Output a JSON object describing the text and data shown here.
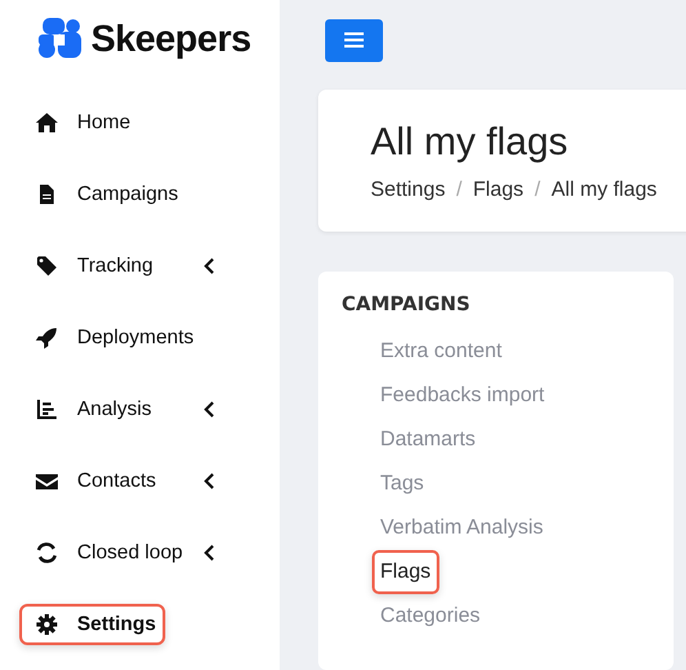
{
  "logo": {
    "text": "Skeepers"
  },
  "sidebar": {
    "items": [
      {
        "label": "Home",
        "expandable": false,
        "selected": false,
        "highlighted": false
      },
      {
        "label": "Campaigns",
        "expandable": false,
        "selected": false,
        "highlighted": false
      },
      {
        "label": "Tracking",
        "expandable": true,
        "selected": false,
        "highlighted": false
      },
      {
        "label": "Deployments",
        "expandable": false,
        "selected": false,
        "highlighted": false
      },
      {
        "label": "Analysis",
        "expandable": true,
        "selected": false,
        "highlighted": false
      },
      {
        "label": "Contacts",
        "expandable": true,
        "selected": false,
        "highlighted": false
      },
      {
        "label": "Closed loop",
        "expandable": true,
        "selected": false,
        "highlighted": false
      },
      {
        "label": "Settings",
        "expandable": false,
        "selected": true,
        "highlighted": true
      }
    ]
  },
  "header": {
    "title": "All my flags",
    "breadcrumb": [
      {
        "label": "Settings"
      },
      {
        "separator": "/",
        "label": "Flags"
      },
      {
        "separator": "/",
        "label": "All my flags"
      }
    ]
  },
  "section": {
    "title": "CAMPAIGNS",
    "links": [
      {
        "label": "Extra content",
        "selected": false,
        "highlighted": false
      },
      {
        "label": "Feedbacks import",
        "selected": false,
        "highlighted": false
      },
      {
        "label": "Datamarts",
        "selected": false,
        "highlighted": false
      },
      {
        "label": "Tags",
        "selected": false,
        "highlighted": false
      },
      {
        "label": "Verbatim Analysis",
        "selected": false,
        "highlighted": false
      },
      {
        "label": "Flags",
        "selected": true,
        "highlighted": true
      },
      {
        "label": "Categories",
        "selected": false,
        "highlighted": false
      }
    ]
  }
}
